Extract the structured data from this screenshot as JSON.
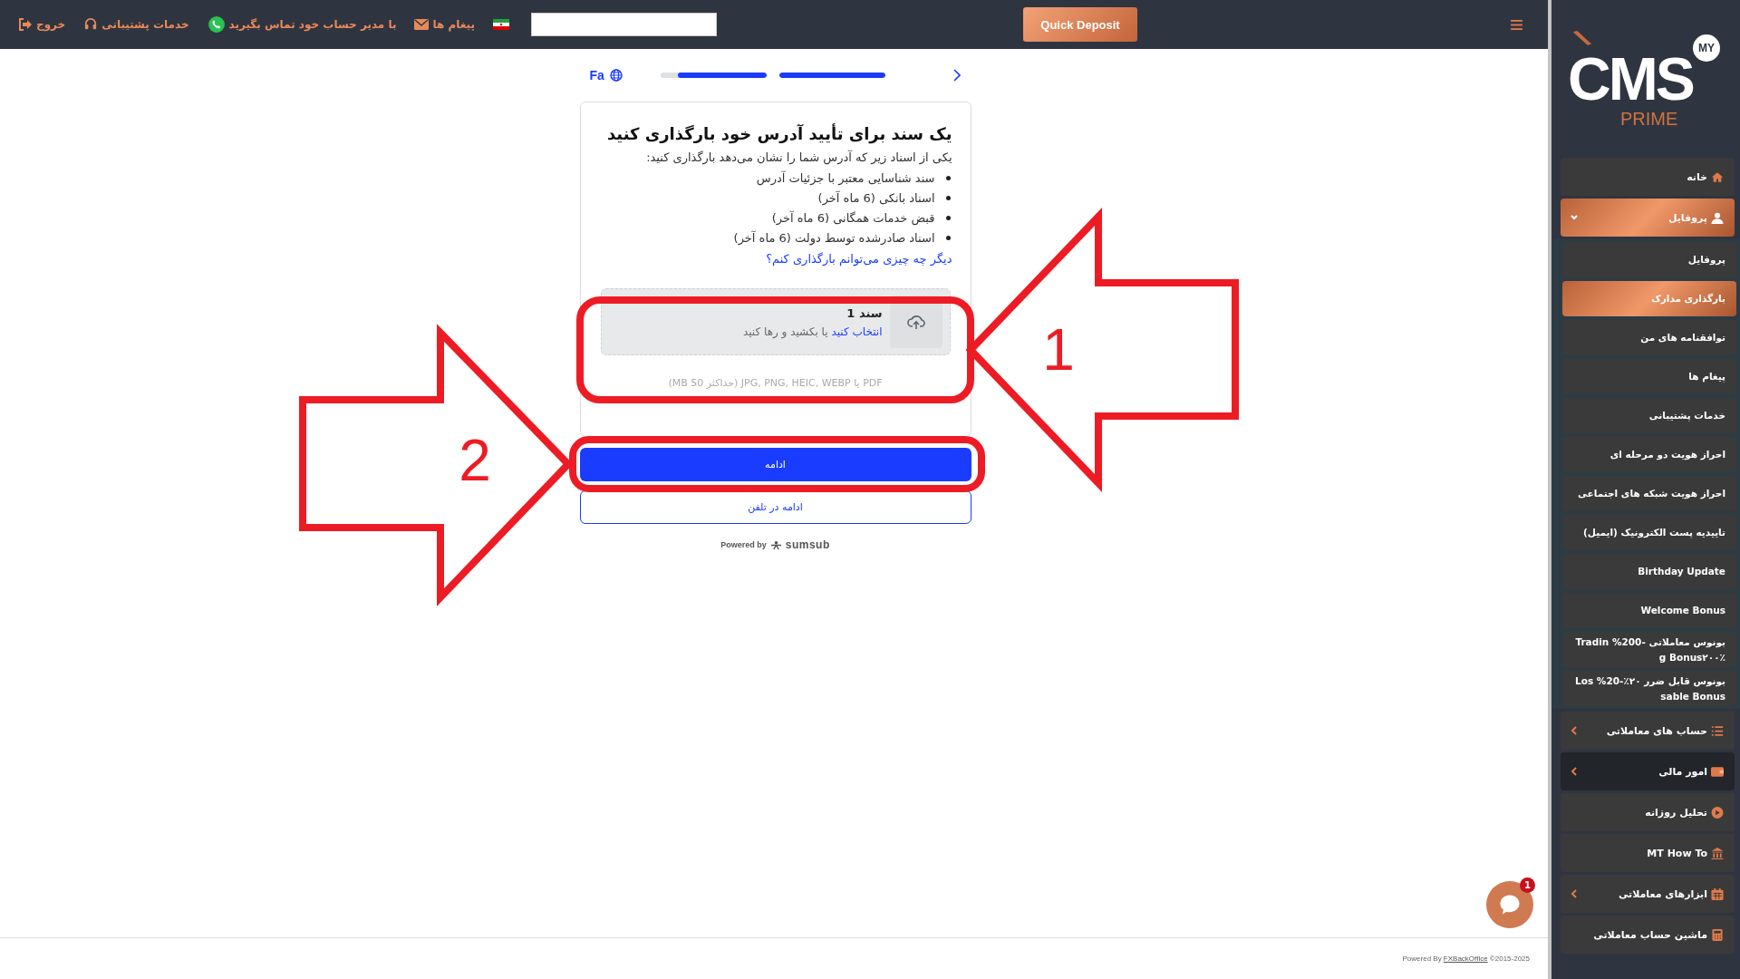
{
  "topbar": {
    "quick_deposit": "Quick Deposit",
    "links": [
      {
        "label": "پیغام ها",
        "kind": "mail"
      },
      {
        "label": "با مدیر حساب خود تماس بگیرید",
        "kind": "whatsapp"
      },
      {
        "label": "خدمات پشتیبانی",
        "kind": "support"
      },
      {
        "label": "خروج",
        "kind": "logout"
      }
    ]
  },
  "steps": {
    "language": "Fa",
    "segments": [
      {
        "level": 0.84
      },
      {
        "level": 1
      }
    ]
  },
  "card": {
    "title": "یک سند برای تأیید آدرس خود بارگذاری کنید",
    "subtitle": "یکی از اسناد زیر که آدرس شما را نشان می‌دهد بارگذاری کنید:",
    "documents": [
      "سند شناسایی معتبر با جزئیات آدرس",
      "اسناد بانکی (6 ماه آخر)",
      "قبض خدمات همگانی (6 ماه آخر)",
      "اسناد صادرشده توسط دولت (6 ماه آخر)"
    ],
    "help_link": "دیگر چه چیزی می‌توانم بارگذاری کنم؟",
    "upload": {
      "title": "سند 1",
      "pick_link": "انتخاب کنید",
      "hint": "یا بکشید و رها کنید"
    },
    "formats": "PDF یا JPG, PNG, HEIC, WEBP (حداکثر 50 MB)"
  },
  "continue_button": "ادامه",
  "phone_button": "ادامه در تلفن",
  "powered": {
    "label": "Powered by",
    "brand": "sumsub"
  },
  "annotations": [
    {
      "number": "1",
      "kind": "left"
    },
    {
      "number": "2",
      "kind": "right"
    }
  ],
  "footer": {
    "prefix": "Powered By",
    "link": "FXBackOffice",
    "suffix": "©2015-2025"
  },
  "sidebar": {
    "logo": {
      "main": "CMS",
      "badge": "MY",
      "sub": "PRIME"
    },
    "items": [
      {
        "label": "خانه",
        "kind": "link",
        "selected": false,
        "hovered": false
      },
      {
        "label": "پروفایل",
        "kind": "group",
        "selected": true,
        "hovered": false,
        "expanded": true,
        "children": [
          {
            "label": "پروفایل",
            "selected": false
          },
          {
            "label": "بارگذاری مدارک",
            "selected": true
          },
          {
            "label": "توافقنامه های من",
            "selected": false
          },
          {
            "label": "پیغام ها",
            "selected": false
          },
          {
            "label": "خدمات پشتیبانی",
            "selected": false
          },
          {
            "label": "احراز هویت دو مرحله ای",
            "selected": false
          },
          {
            "label": "احراز هویت شبکه های اجتماعی",
            "selected": false
          },
          {
            "label": "تاییدیه پست الکترونیک (ایمیل)",
            "selected": false
          },
          {
            "label": "Birthday Update",
            "selected": false
          },
          {
            "label": "Welcome Bonus",
            "selected": false
          },
          {
            "label": "بونوس معاملاتی -200% Trading Bonus۲۰۰٪",
            "selected": false
          },
          {
            "label": "بونوس قابل ضرر ۲۰٪-20% Lossable Bonus",
            "selected": false
          }
        ]
      },
      {
        "label": "حساب های معاملاتی",
        "kind": "group",
        "selected": false,
        "hovered": false,
        "expanded": false
      },
      {
        "label": "امور مالی",
        "kind": "group",
        "selected": false,
        "hovered": true,
        "expanded": false
      },
      {
        "label": "تحلیل روزانه",
        "kind": "link",
        "selected": false,
        "hovered": false
      },
      {
        "label": "MT How To",
        "kind": "link",
        "selected": false,
        "hovered": false
      },
      {
        "label": "ابزارهای معاملاتی",
        "kind": "group",
        "selected": false,
        "hovered": false,
        "expanded": false
      },
      {
        "label": "ماشین حساب معاملاتی",
        "kind": "link",
        "selected": false,
        "hovered": false
      }
    ]
  },
  "chat": {
    "unread": "1"
  }
}
